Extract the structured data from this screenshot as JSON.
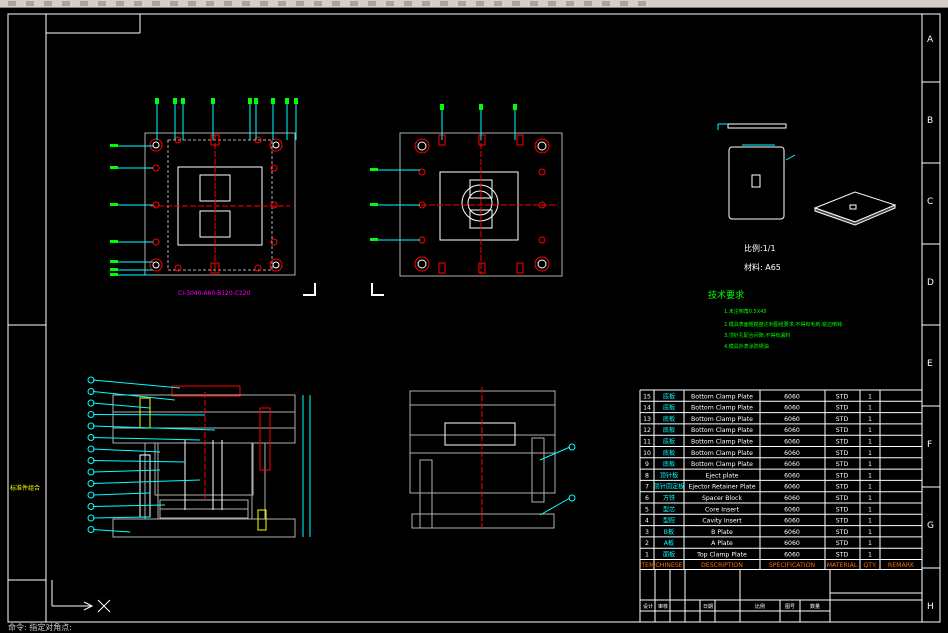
{
  "window": {
    "title": "",
    "status_text": "命令: 指定对角点:"
  },
  "border_letters": [
    "A",
    "B",
    "C",
    "D",
    "E",
    "F",
    "G",
    "H"
  ],
  "colors": {
    "background": "#000000",
    "frame": "#ffffff",
    "cyan": "#00ffff",
    "green": "#00ff00",
    "red": "#ff0000",
    "yellow": "#ffff00",
    "magenta": "#ff00ff",
    "grey": "#b0b0b0"
  },
  "top_view": {
    "caption": "CI-3040-A60-B120-C120"
  },
  "part_detail": {
    "scale_label": "比例:1/1",
    "material_label": "材料: A65"
  },
  "tech_requirements": {
    "title": "技术要求",
    "items": [
      "1.未注倒角0.5X45",
      "2.模具表面粗糙度达到图纸要求,不得有毛刺,锐边倒钝",
      "3.顶针孔配合间隙,不得有漏料",
      "4.模具外表涂防锈油"
    ]
  },
  "side_label": "标准件组合",
  "bom": {
    "rows": [
      {
        "no": "15",
        "cn": "底板",
        "desc": "Bottom Clamp Plate",
        "spec": "6060",
        "mat": "STD",
        "qty": "1"
      },
      {
        "no": "14",
        "cn": "底板",
        "desc": "Bottom Clamp Plate",
        "spec": "6060",
        "mat": "STD",
        "qty": "1"
      },
      {
        "no": "13",
        "cn": "底板",
        "desc": "Bottom Clamp Plate",
        "spec": "6060",
        "mat": "STD",
        "qty": "1"
      },
      {
        "no": "12",
        "cn": "底板",
        "desc": "Bottom Clamp Plate",
        "spec": "6060",
        "mat": "STD",
        "qty": "1"
      },
      {
        "no": "11",
        "cn": "底板",
        "desc": "Bottom Clamp Plate",
        "spec": "6060",
        "mat": "STD",
        "qty": "1"
      },
      {
        "no": "10",
        "cn": "底板",
        "desc": "Bottom Clamp Plate",
        "spec": "6060",
        "mat": "STD",
        "qty": "1"
      },
      {
        "no": "9",
        "cn": "底板",
        "desc": "Bottom Clamp Plate",
        "spec": "6060",
        "mat": "STD",
        "qty": "1"
      },
      {
        "no": "8",
        "cn": "顶针板",
        "desc": "Eject plate",
        "spec": "6060",
        "mat": "STD",
        "qty": "1"
      },
      {
        "no": "7",
        "cn": "顶针固定板",
        "desc": "Ejector Retainer Plate",
        "spec": "6060",
        "mat": "STD",
        "qty": "1"
      },
      {
        "no": "6",
        "cn": "方铁",
        "desc": "Spacer Block",
        "spec": "6060",
        "mat": "STD",
        "qty": "1"
      },
      {
        "no": "5",
        "cn": "型芯",
        "desc": "Core Insert",
        "spec": "6060",
        "mat": "STD",
        "qty": "1"
      },
      {
        "no": "4",
        "cn": "型腔",
        "desc": "Cavity Insert",
        "spec": "6060",
        "mat": "STD",
        "qty": "1"
      },
      {
        "no": "3",
        "cn": "B板",
        "desc": "B Plate",
        "spec": "6060",
        "mat": "STD",
        "qty": "1"
      },
      {
        "no": "2",
        "cn": "A板",
        "desc": "A Plate",
        "spec": "6060",
        "mat": "STD",
        "qty": "1"
      },
      {
        "no": "1",
        "cn": "面板",
        "desc": "Top Clamp Plate",
        "spec": "6060",
        "mat": "STD",
        "qty": "1"
      }
    ],
    "headers": {
      "item": "ITEM",
      "cn": "CHINESE",
      "desc": "DESCRIPTION",
      "spec": "SPECIFICATION",
      "mat": "MATERIAL",
      "qty": "QTY.",
      "remark": "REMARK"
    }
  },
  "title_block": {
    "labels": [
      "设计",
      "审核",
      "日期",
      "比例",
      "图号",
      "数量"
    ]
  }
}
